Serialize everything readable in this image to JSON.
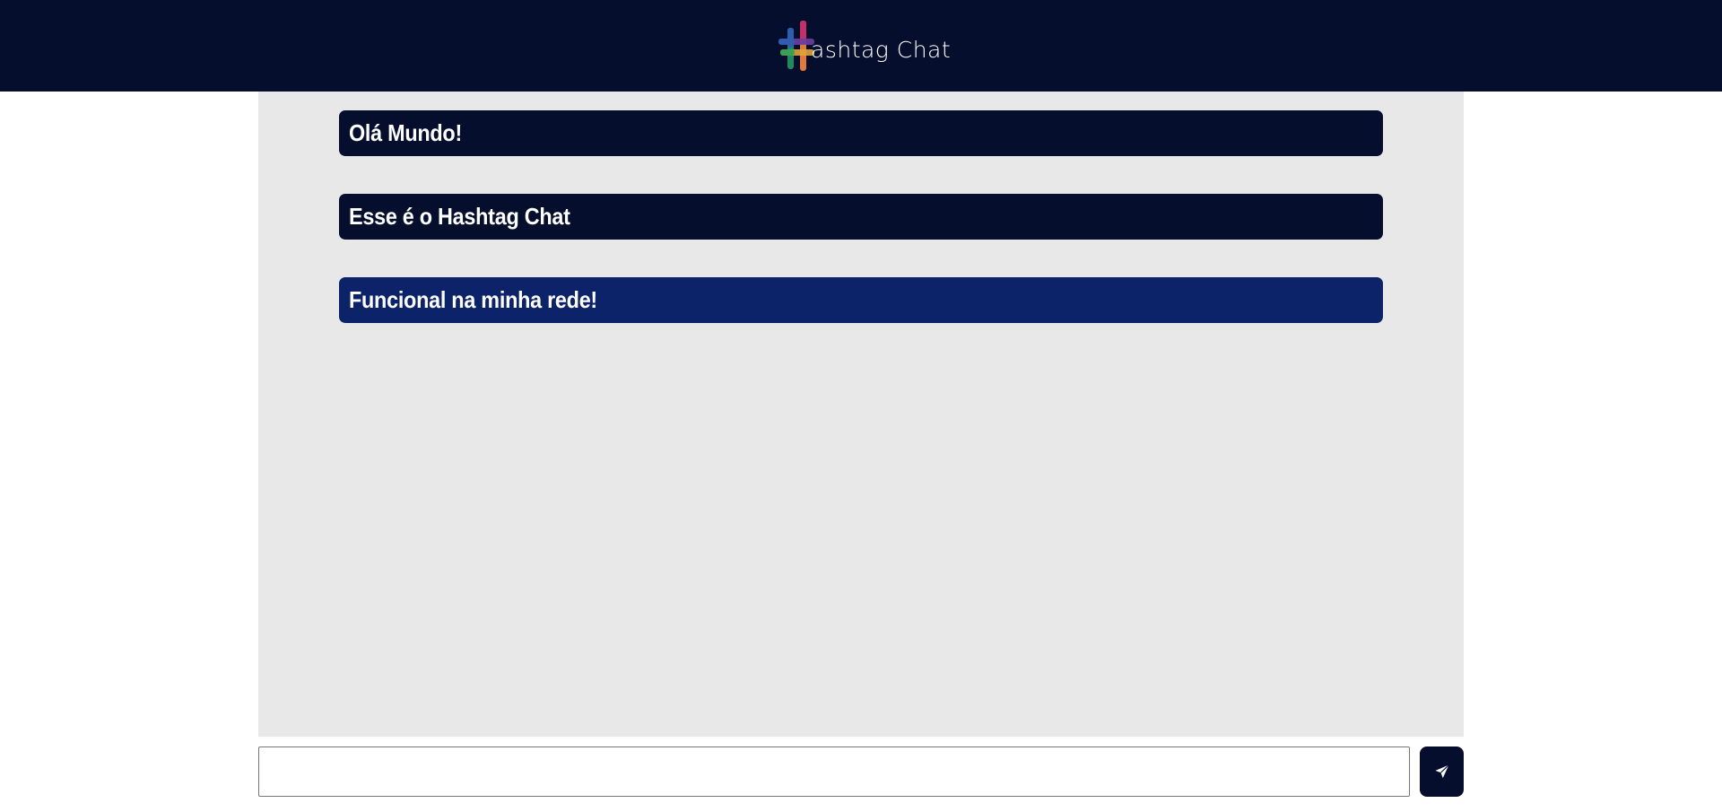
{
  "header": {
    "logo_text": "ashtag Chat",
    "logo_icon": "hashtag-logo-icon"
  },
  "messages": [
    {
      "text": "Olá Mundo!"
    },
    {
      "text": "Esse é o Hashtag Chat"
    },
    {
      "text": "Funcional na minha rede!"
    }
  ],
  "composer": {
    "value": "",
    "placeholder": "",
    "send_icon": "paper-plane-icon"
  },
  "colors": {
    "header_bg": "#050e2c",
    "message_bg": "#050e2c",
    "message_highlight_bg": "#0c2369",
    "chat_bg": "#e8e8e8"
  }
}
